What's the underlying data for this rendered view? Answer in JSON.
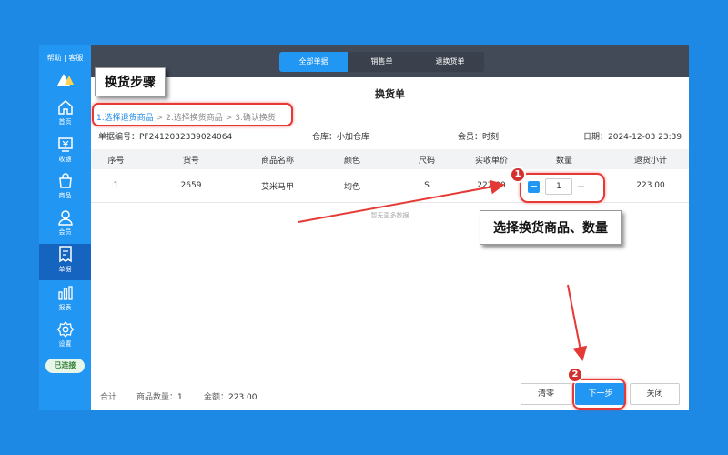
{
  "sidebar": {
    "help_label": "帮助 | 客服",
    "items": [
      {
        "label": "首页",
        "icon": "home-icon"
      },
      {
        "label": "收银",
        "icon": "cashier-icon"
      },
      {
        "label": "商品",
        "icon": "bag-icon"
      },
      {
        "label": "会员",
        "icon": "user-icon"
      },
      {
        "label": "单据",
        "icon": "receipt-icon",
        "active": true
      },
      {
        "label": "报表",
        "icon": "chart-icon"
      },
      {
        "label": "设置",
        "icon": "gear-icon"
      }
    ],
    "status": "已连接"
  },
  "top_tabs": [
    {
      "label": "全部单据",
      "active": true
    },
    {
      "label": "销售单"
    },
    {
      "label": "退换货单"
    }
  ],
  "page_title": "换货单",
  "steps": {
    "step1": "1.选择退货商品",
    "step2": "2.选择换货商品",
    "step3": "3.确认换货",
    "separator": ">"
  },
  "info": {
    "order_no": "单据编号：PF2412032339024064",
    "warehouse": "仓库：小加仓库",
    "member": "会员：时刻",
    "date": "日期：2024-12-03 23:39"
  },
  "table": {
    "headers": [
      "序号",
      "货号",
      "商品名称",
      "颜色",
      "尺码",
      "实收单价",
      "数量",
      "退货小计"
    ],
    "row": {
      "index": "1",
      "sku": "2659",
      "name": "艾米马甲",
      "color": "均色",
      "size": "S",
      "price": "222.00",
      "quantity": "1",
      "subtotal": "223.00"
    },
    "empty_text": "暂无更多数据"
  },
  "footer": {
    "total_label": "合计",
    "count_label": "商品数量：",
    "count_value": "1",
    "amount_label": "金额：",
    "amount_value": "223.00"
  },
  "buttons": {
    "clear": "清零",
    "next": "下一步",
    "close": "关闭"
  },
  "annotations": {
    "steps_callout": "换货步骤",
    "select_callout": "选择换货商品、数量",
    "badge1": "1",
    "badge2": "2"
  },
  "colors": {
    "background": "#1e88e5",
    "sidebar": "#2196f3",
    "accent": "#2196f3",
    "annotation_red": "#e53935"
  }
}
